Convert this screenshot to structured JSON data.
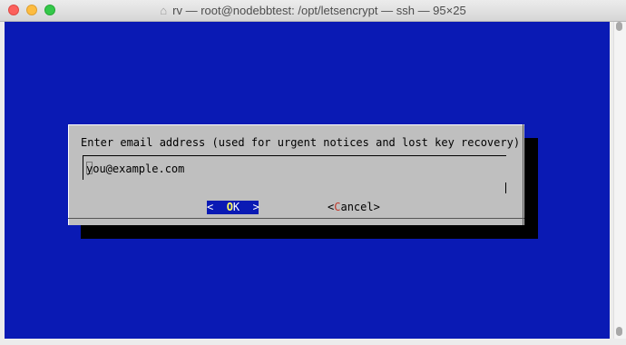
{
  "window": {
    "title": "rv — root@nodebbtest: /opt/letsencrypt — ssh — 95×25",
    "title_icon": "house-icon"
  },
  "dialog": {
    "prompt": "Enter email address (used for urgent notices and lost key recovery)",
    "input_value": "you@example.com",
    "ok_left": "<  ",
    "ok_hotkey": "O",
    "ok_rest": "K  >",
    "cancel_left": "<",
    "cancel_hotkey": "C",
    "cancel_rest": "ancel>"
  },
  "colors": {
    "terminal_background": "#0a1ab4",
    "dialog_background": "#bfbfbf",
    "dialog_shadow": "#000000",
    "selected_button": "#0a1ab4"
  }
}
